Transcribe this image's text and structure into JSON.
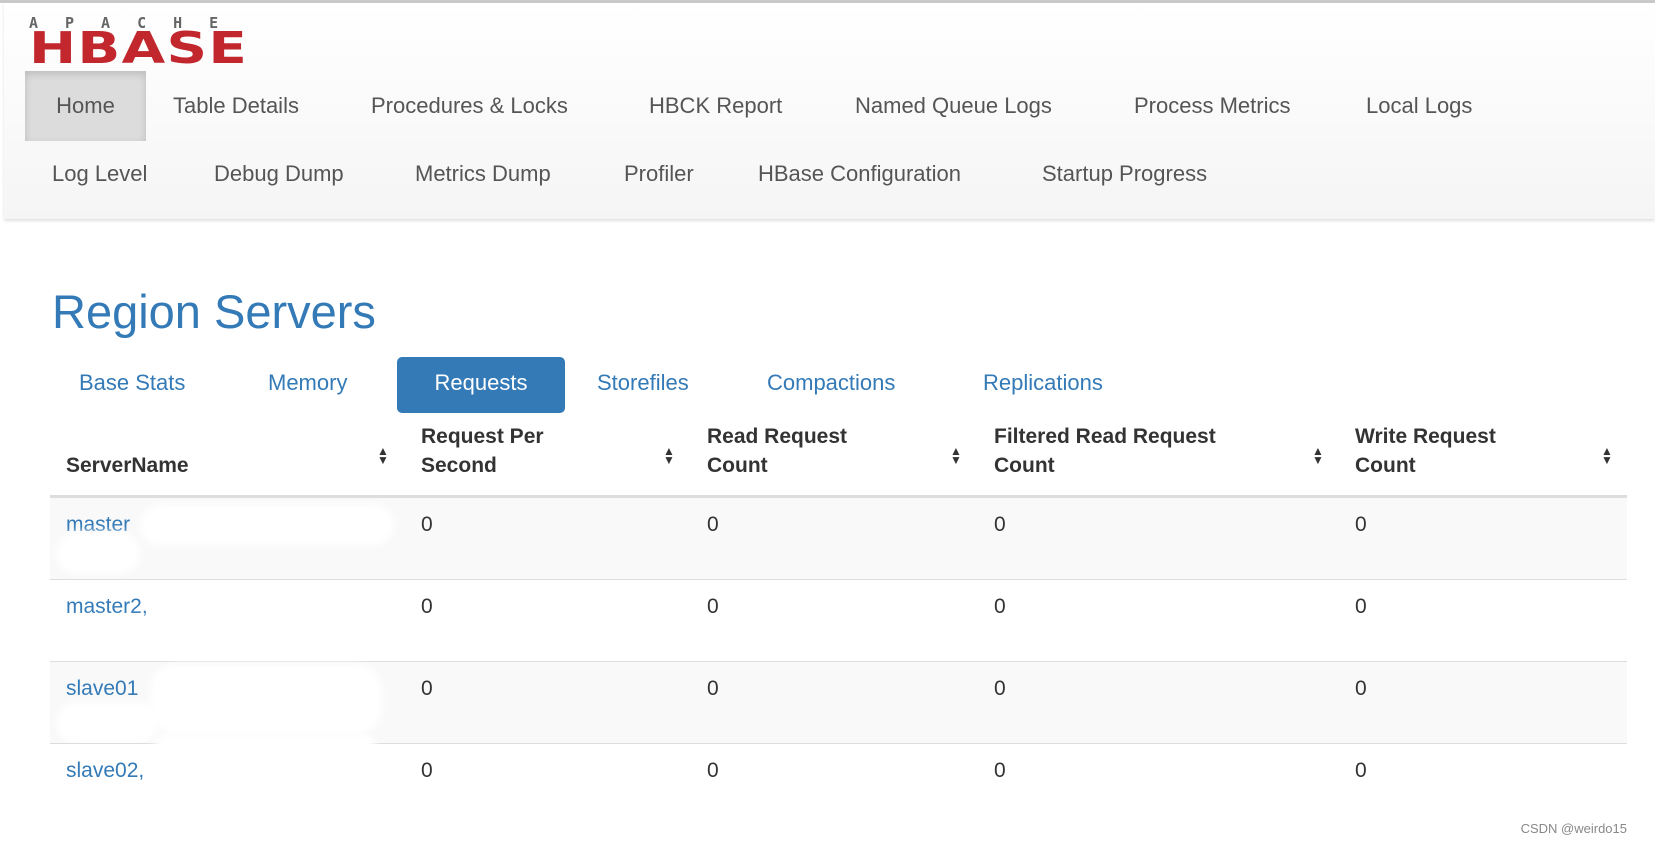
{
  "logo": {
    "top": "APACHE",
    "main": "HBASE"
  },
  "nav": {
    "row1": [
      "Home",
      "Table Details",
      "Procedures & Locks",
      "HBCK Report",
      "Named Queue Logs",
      "Process Metrics",
      "Local Logs"
    ],
    "row2": [
      "Log Level",
      "Debug Dump",
      "Metrics Dump",
      "Profiler",
      "HBase Configuration",
      "Startup Progress"
    ],
    "active": "Home"
  },
  "page": {
    "title": "Region Servers"
  },
  "tabs": {
    "items": [
      "Base Stats",
      "Memory",
      "Requests",
      "Storefiles",
      "Compactions",
      "Replications"
    ],
    "active": "Requests"
  },
  "table": {
    "columns": [
      "ServerName",
      "Request Per Second",
      "Read Request Count",
      "Filtered Read Request Count",
      "Write Request Count"
    ],
    "column_lines": [
      [
        "ServerName"
      ],
      [
        "Request Per",
        "Second"
      ],
      [
        "Read Request",
        "Count"
      ],
      [
        "Filtered Read Request",
        "Count"
      ],
      [
        "Write Request",
        "Count"
      ]
    ],
    "rows": [
      {
        "server": "master",
        "rps": "0",
        "read": "0",
        "filtered": "0",
        "write": "0"
      },
      {
        "server": "master2,",
        "rps": "0",
        "read": "0",
        "filtered": "0",
        "write": "0"
      },
      {
        "server": "slave01",
        "rps": "0",
        "read": "0",
        "filtered": "0",
        "write": "0"
      },
      {
        "server": "slave02,",
        "rps": "0",
        "read": "0",
        "filtered": "0",
        "write": "0"
      }
    ]
  },
  "watermark": "CSDN @weirdo15",
  "colors": {
    "link": "#337ab7",
    "brand": "#c1272d",
    "active_tab": "#337ab7"
  }
}
